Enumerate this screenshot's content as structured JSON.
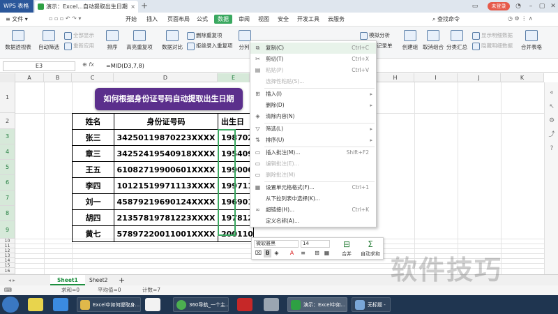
{
  "titlebar": {
    "app": "WPS 表格",
    "doc_tab": "演示：Excel...自动提取出生日期",
    "login": "未登录"
  },
  "menu": {
    "file": "文件",
    "items": [
      "开始",
      "插入",
      "页面布局",
      "公式",
      "数据",
      "审阅",
      "视图",
      "安全",
      "开发工具",
      "云服务"
    ],
    "active": "数据",
    "search": "查找命令"
  },
  "ribbon": {
    "pivot": "数据透视表",
    "autofilter": "自动筛选",
    "show_all": "全部显示",
    "reapply": "重新应用",
    "sort": "排序",
    "highlight_dup": "高亮重复项",
    "compare": "数据对比",
    "remove_dup": "删除重复项",
    "reject_dup": "拒绝录入重复项",
    "split": "分列",
    "whatif": "模拟分析",
    "record": "记录单",
    "create_group": "创建组",
    "ungroup": "取消组合",
    "subtotal": "分类汇总",
    "show_detail": "显示明细数据",
    "hide_detail": "隐藏明细数据",
    "merge": "合并表格"
  },
  "formula_bar": {
    "cell_ref": "E3",
    "fx": "fx",
    "formula": "=MID(D3,7,8)"
  },
  "columns": [
    "A",
    "B",
    "C",
    "D",
    "E",
    "F",
    "G",
    "H",
    "I",
    "J",
    "K"
  ],
  "rows": [
    "1",
    "2",
    "3",
    "4",
    "5",
    "6",
    "7",
    "8",
    "9",
    "10",
    "11",
    "12",
    "13",
    "14",
    "15",
    "16",
    "17",
    "18",
    "19",
    "20"
  ],
  "banner": "如何根据身份证号码自动提取出生日期",
  "table": {
    "headers": [
      "姓名",
      "身份证号码",
      "出生日"
    ],
    "rows": [
      [
        "张三",
        "34250119870223XXXX",
        "198702"
      ],
      [
        "章三",
        "34252419540918XXXX",
        "195409"
      ],
      [
        "王五",
        "61082719900601XXXX",
        "199006"
      ],
      [
        "李四",
        "10121519971113XXXX",
        "199711"
      ],
      [
        "刘一",
        "45879219690124XXXX",
        "196901"
      ],
      [
        "胡四",
        "21357819781223XXXX",
        "197812"
      ],
      [
        "黄七",
        "57897220011001XXXX",
        "200110"
      ]
    ]
  },
  "context_menu": {
    "copy": "复制(C)",
    "copy_sc": "Ctrl+C",
    "cut": "剪切(T)",
    "cut_sc": "Ctrl+X",
    "paste": "粘贴(P)",
    "paste_sc": "Ctrl+V",
    "paste_special": "选择性粘贴(S)...",
    "insert": "插入(I)",
    "delete": "删除(D)",
    "clear": "清除内容(N)",
    "filter": "筛选(L)",
    "sort": "排序(U)",
    "insert_comment": "插入批注(M)...",
    "insert_comment_sc": "Shift+F2",
    "edit_comment": "编辑批注(E)...",
    "delete_comment": "删除批注(M)",
    "format_cells": "设置单元格格式(F)...",
    "format_cells_sc": "Ctrl+1",
    "pick_list": "从下拉列表中选择(K)...",
    "hyperlink": "超链接(H)...",
    "hyperlink_sc": "Ctrl+K",
    "define_name": "定义名称(A)..."
  },
  "mini_toolbar": {
    "font": "微软雅黑",
    "size": "14",
    "merge": "合并",
    "autosum": "自动求和"
  },
  "sheets": [
    "Sheet1",
    "Sheet2"
  ],
  "status": {
    "sum": "求和=0",
    "avg": "平均值=0",
    "count": "计数=7"
  },
  "taskbar": {
    "excel_task": "Excel中如何提取身...",
    "browser_task": "360导航_一个主...",
    "wps_task": "演示：Excel中如...",
    "untitled_task": "无标题 -"
  },
  "watermark": "软件技巧",
  "colors": {
    "brand_green": "#3aa860",
    "banner_purple": "#5b2f8c",
    "taskbar": "#1f3550"
  }
}
